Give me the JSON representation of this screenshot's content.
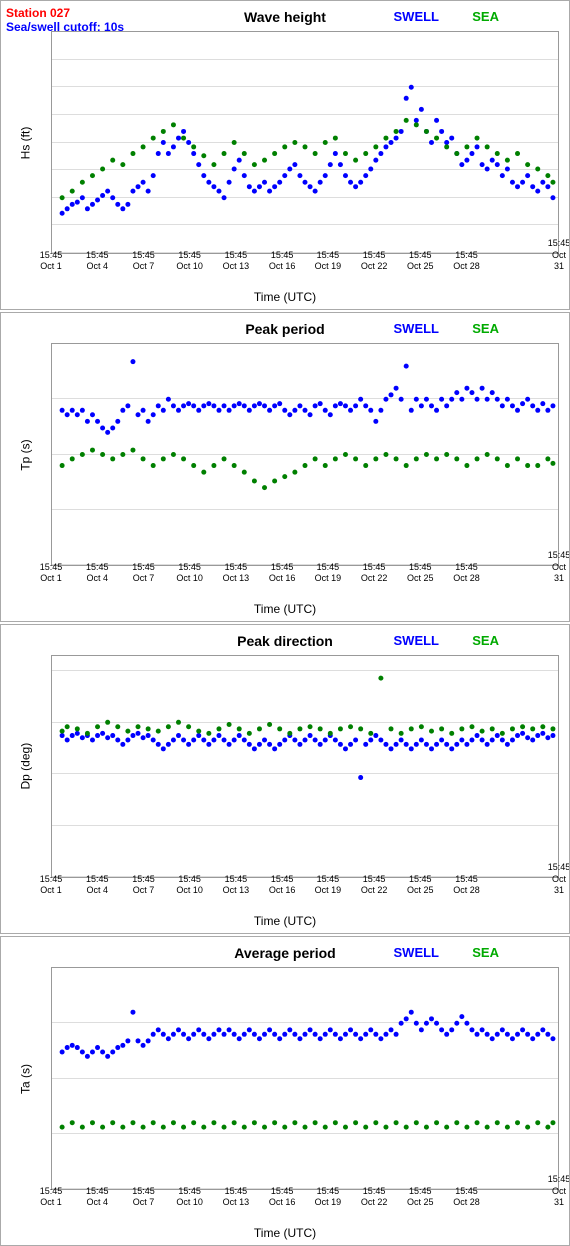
{
  "header": {
    "station": "Station 027",
    "cutoff": "Sea/swell cutoff: 10s",
    "wave_height_title": "Wave height",
    "peak_period_title": "Peak period",
    "peak_direction_title": "Peak direction",
    "average_period_title": "Average period",
    "swell_label": "SWELL",
    "sea_label": "SEA"
  },
  "charts": [
    {
      "id": "wave-height",
      "title": "Wave height",
      "y_label": "Hs (ft)",
      "y_min": 0.0,
      "y_max": 4.0,
      "y_ticks": [
        0.0,
        0.5,
        1.0,
        1.5,
        2.0,
        2.5,
        3.0,
        3.5,
        4.0
      ]
    },
    {
      "id": "peak-period",
      "title": "Peak period",
      "y_label": "Tp (s)",
      "y_min": 0,
      "y_max": 20,
      "y_ticks": [
        0,
        5,
        10,
        15,
        20
      ]
    },
    {
      "id": "peak-direction",
      "title": "Peak direction",
      "y_label": "Dp (deg)",
      "y_min": -70,
      "y_max": 360,
      "y_ticks": [
        -70,
        30,
        130,
        230,
        330
      ]
    },
    {
      "id": "average-period",
      "title": "Average period",
      "y_label": "Ta (s)",
      "y_min": 0,
      "y_max": 20,
      "y_ticks": [
        0,
        5,
        10,
        15,
        20
      ]
    }
  ],
  "x_ticks": [
    {
      "label": "15:45\nOct 1",
      "pos_pct": 0
    },
    {
      "label": "15:45\nOct 4",
      "pos_pct": 9.1
    },
    {
      "label": "15:45\nOct 7",
      "pos_pct": 18.2
    },
    {
      "label": "15:45\nOct 10",
      "pos_pct": 27.3
    },
    {
      "label": "15:45\nOct 13",
      "pos_pct": 36.4
    },
    {
      "label": "15:45\nOct 16",
      "pos_pct": 45.5
    },
    {
      "label": "15:45\nOct 19",
      "pos_pct": 54.5
    },
    {
      "label": "15:45\nOct 22",
      "pos_pct": 63.6
    },
    {
      "label": "15:45\nOct 25",
      "pos_pct": 72.7
    },
    {
      "label": "15:45\nOct 28",
      "pos_pct": 81.8
    },
    {
      "label": "15:45\nOct 31",
      "pos_pct": 100
    }
  ],
  "time_label": "Time (UTC)"
}
